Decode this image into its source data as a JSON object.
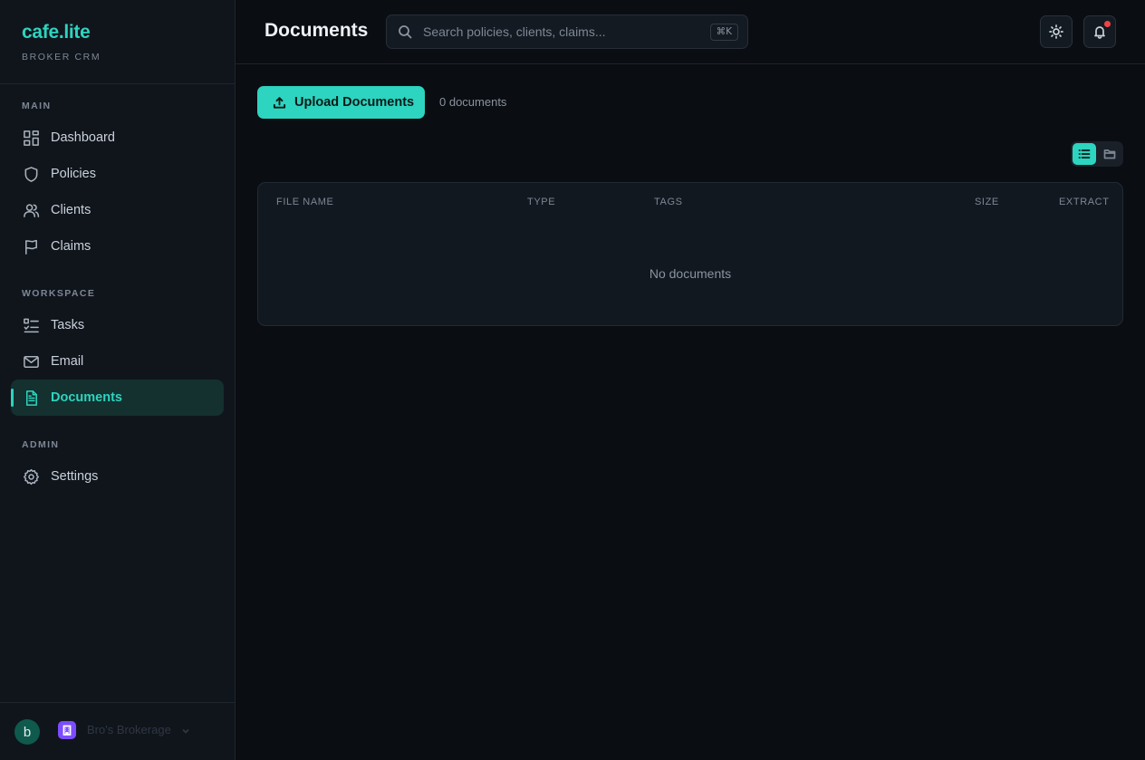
{
  "brand": {
    "name": "cafe.lite",
    "subtitle": "BROKER CRM"
  },
  "sidebar": {
    "sections": [
      {
        "label": "MAIN"
      },
      {
        "label": "WORKSPACE"
      },
      {
        "label": "ADMIN"
      }
    ],
    "items": [
      {
        "label": "Dashboard",
        "icon": "grid-icon"
      },
      {
        "label": "Policies",
        "icon": "shield-icon"
      },
      {
        "label": "Clients",
        "icon": "users-icon"
      },
      {
        "label": "Claims",
        "icon": "flag-icon"
      },
      {
        "label": "Tasks",
        "icon": "checklist-icon"
      },
      {
        "label": "Email",
        "icon": "mail-icon"
      },
      {
        "label": "Documents",
        "icon": "file-text-icon",
        "active": true
      },
      {
        "label": "Settings",
        "icon": "gear-icon"
      }
    ],
    "footer": {
      "avatar_initial": "b",
      "org_name": "Bro's Brokerage"
    }
  },
  "header": {
    "title": "Documents",
    "search": {
      "placeholder": "Search policies, clients, claims...",
      "value": "",
      "shortcut": "⌘K"
    }
  },
  "toolbar": {
    "upload_label": "Upload Documents",
    "count_label": "0 documents"
  },
  "table": {
    "columns": [
      "FILE NAME",
      "TYPE",
      "TAGS",
      "SIZE",
      "EXTRACT"
    ],
    "rows": [],
    "empty_message": "No documents"
  },
  "colors": {
    "accent": "#2dd4bf",
    "background": "#0a0d12",
    "sidebar": "#10151c",
    "notification": "#ef4444",
    "org_badge": "#7c4dff"
  }
}
